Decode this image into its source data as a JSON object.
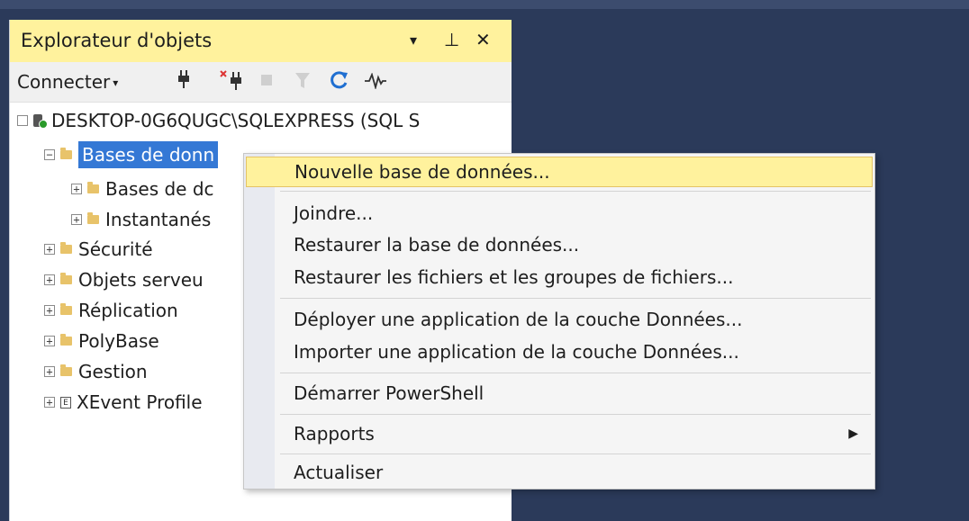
{
  "panel": {
    "title": "Explorateur d'objets",
    "title_icons": [
      "dropdown-caret-icon",
      "pin-icon",
      "close-icon"
    ],
    "title_glyphs": {
      "dropdown": "▾",
      "pin": "⊥",
      "close": "✕"
    }
  },
  "toolbar": {
    "connect_label": "Connecter",
    "connect_caret": "▾",
    "icons": [
      "connect-plug-icon",
      "disconnect-icon",
      "stop-icon",
      "filter-icon",
      "refresh-icon",
      "activity-monitor-icon"
    ]
  },
  "tree": {
    "server": "DESKTOP-0G6QUGC\\SQLEXPRESS (SQL S",
    "databases": "Bases de données",
    "databases_visible": "Bases de donn",
    "system_databases": "Bases de dc",
    "snapshots": "Instantanés",
    "security": "Sécurité",
    "server_objects": "Objets serveu",
    "replication": "Réplication",
    "polybase": "PolyBase",
    "management": "Gestion",
    "xevent": "XEvent Profile",
    "expand_glyph": "⊞",
    "collapse_glyph": "⊟"
  },
  "context_menu": {
    "items": [
      {
        "label": "Nouvelle base de données..."
      },
      {
        "label": "Joindre..."
      },
      {
        "label": "Restaurer la base de données..."
      },
      {
        "label": "Restaurer les fichiers et les groupes de fichiers..."
      },
      {
        "label": "Déployer une application de la couche Données..."
      },
      {
        "label": "Importer une application de la couche Données..."
      },
      {
        "label": "Démarrer PowerShell"
      },
      {
        "label": "Rapports"
      },
      {
        "label": "Actualiser"
      }
    ],
    "submenu_arrow": "▶"
  },
  "colors": {
    "title_bg": "#fff29d",
    "selection": "#3478d5",
    "highlight": "#fff29d",
    "background": "#2b3a5a"
  }
}
